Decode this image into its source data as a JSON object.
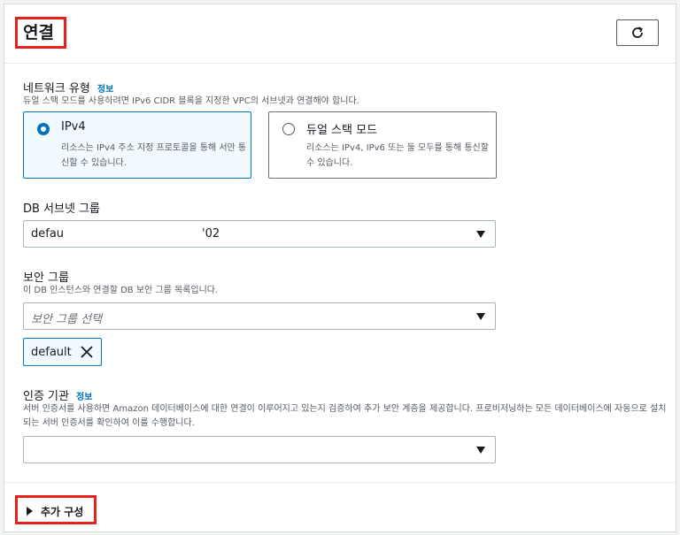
{
  "header": {
    "title": "연결",
    "refresh_icon": "refresh-icon"
  },
  "network_type": {
    "label": "네트워크 유형",
    "info": "정보",
    "description": "듀얼 스택 모드를 사용하려면 IPv6 CIDR 블록을 지정한 VPC의 서브넷과 연결해야 합니다.",
    "options": [
      {
        "title": "IPv4",
        "description": "리소스는 IPv4 주소 지정 프로토콜을 통해 서만 통신할 수 있습니다.",
        "selected": true
      },
      {
        "title": "듀얼 스택 모드",
        "description": "리소스는 IPv4, IPv6 또는 둘 모두를 통해 통신할 수 있습니다.",
        "selected": false
      }
    ]
  },
  "subnet_group": {
    "label": "DB 서브넷 그룹",
    "value_start": "defau",
    "value_end": "'02"
  },
  "security_group": {
    "label": "보안 그룹",
    "description": "이 DB 인스턴스와 연결할 DB 보안 그룹 목록입니다.",
    "placeholder": "보안 그룹 선택",
    "token": "default"
  },
  "certificate_authority": {
    "label": "인증 기관",
    "info": "정보",
    "description": "서버 인증서를 사용하면 Amazon 데이터베이스에 대한 연결이 이루어지고 있는지 검증하여 추가 보안 계층을 제공합니다. 프로비저닝하는 모든 데이터베이스에 자동으로 설치되는 서버 인증서를 확인하여 이를 수행합니다.",
    "value": ""
  },
  "footer": {
    "additional_config": "추가 구성"
  },
  "colors": {
    "highlight": "#e8201a",
    "accent": "#0073bb"
  }
}
